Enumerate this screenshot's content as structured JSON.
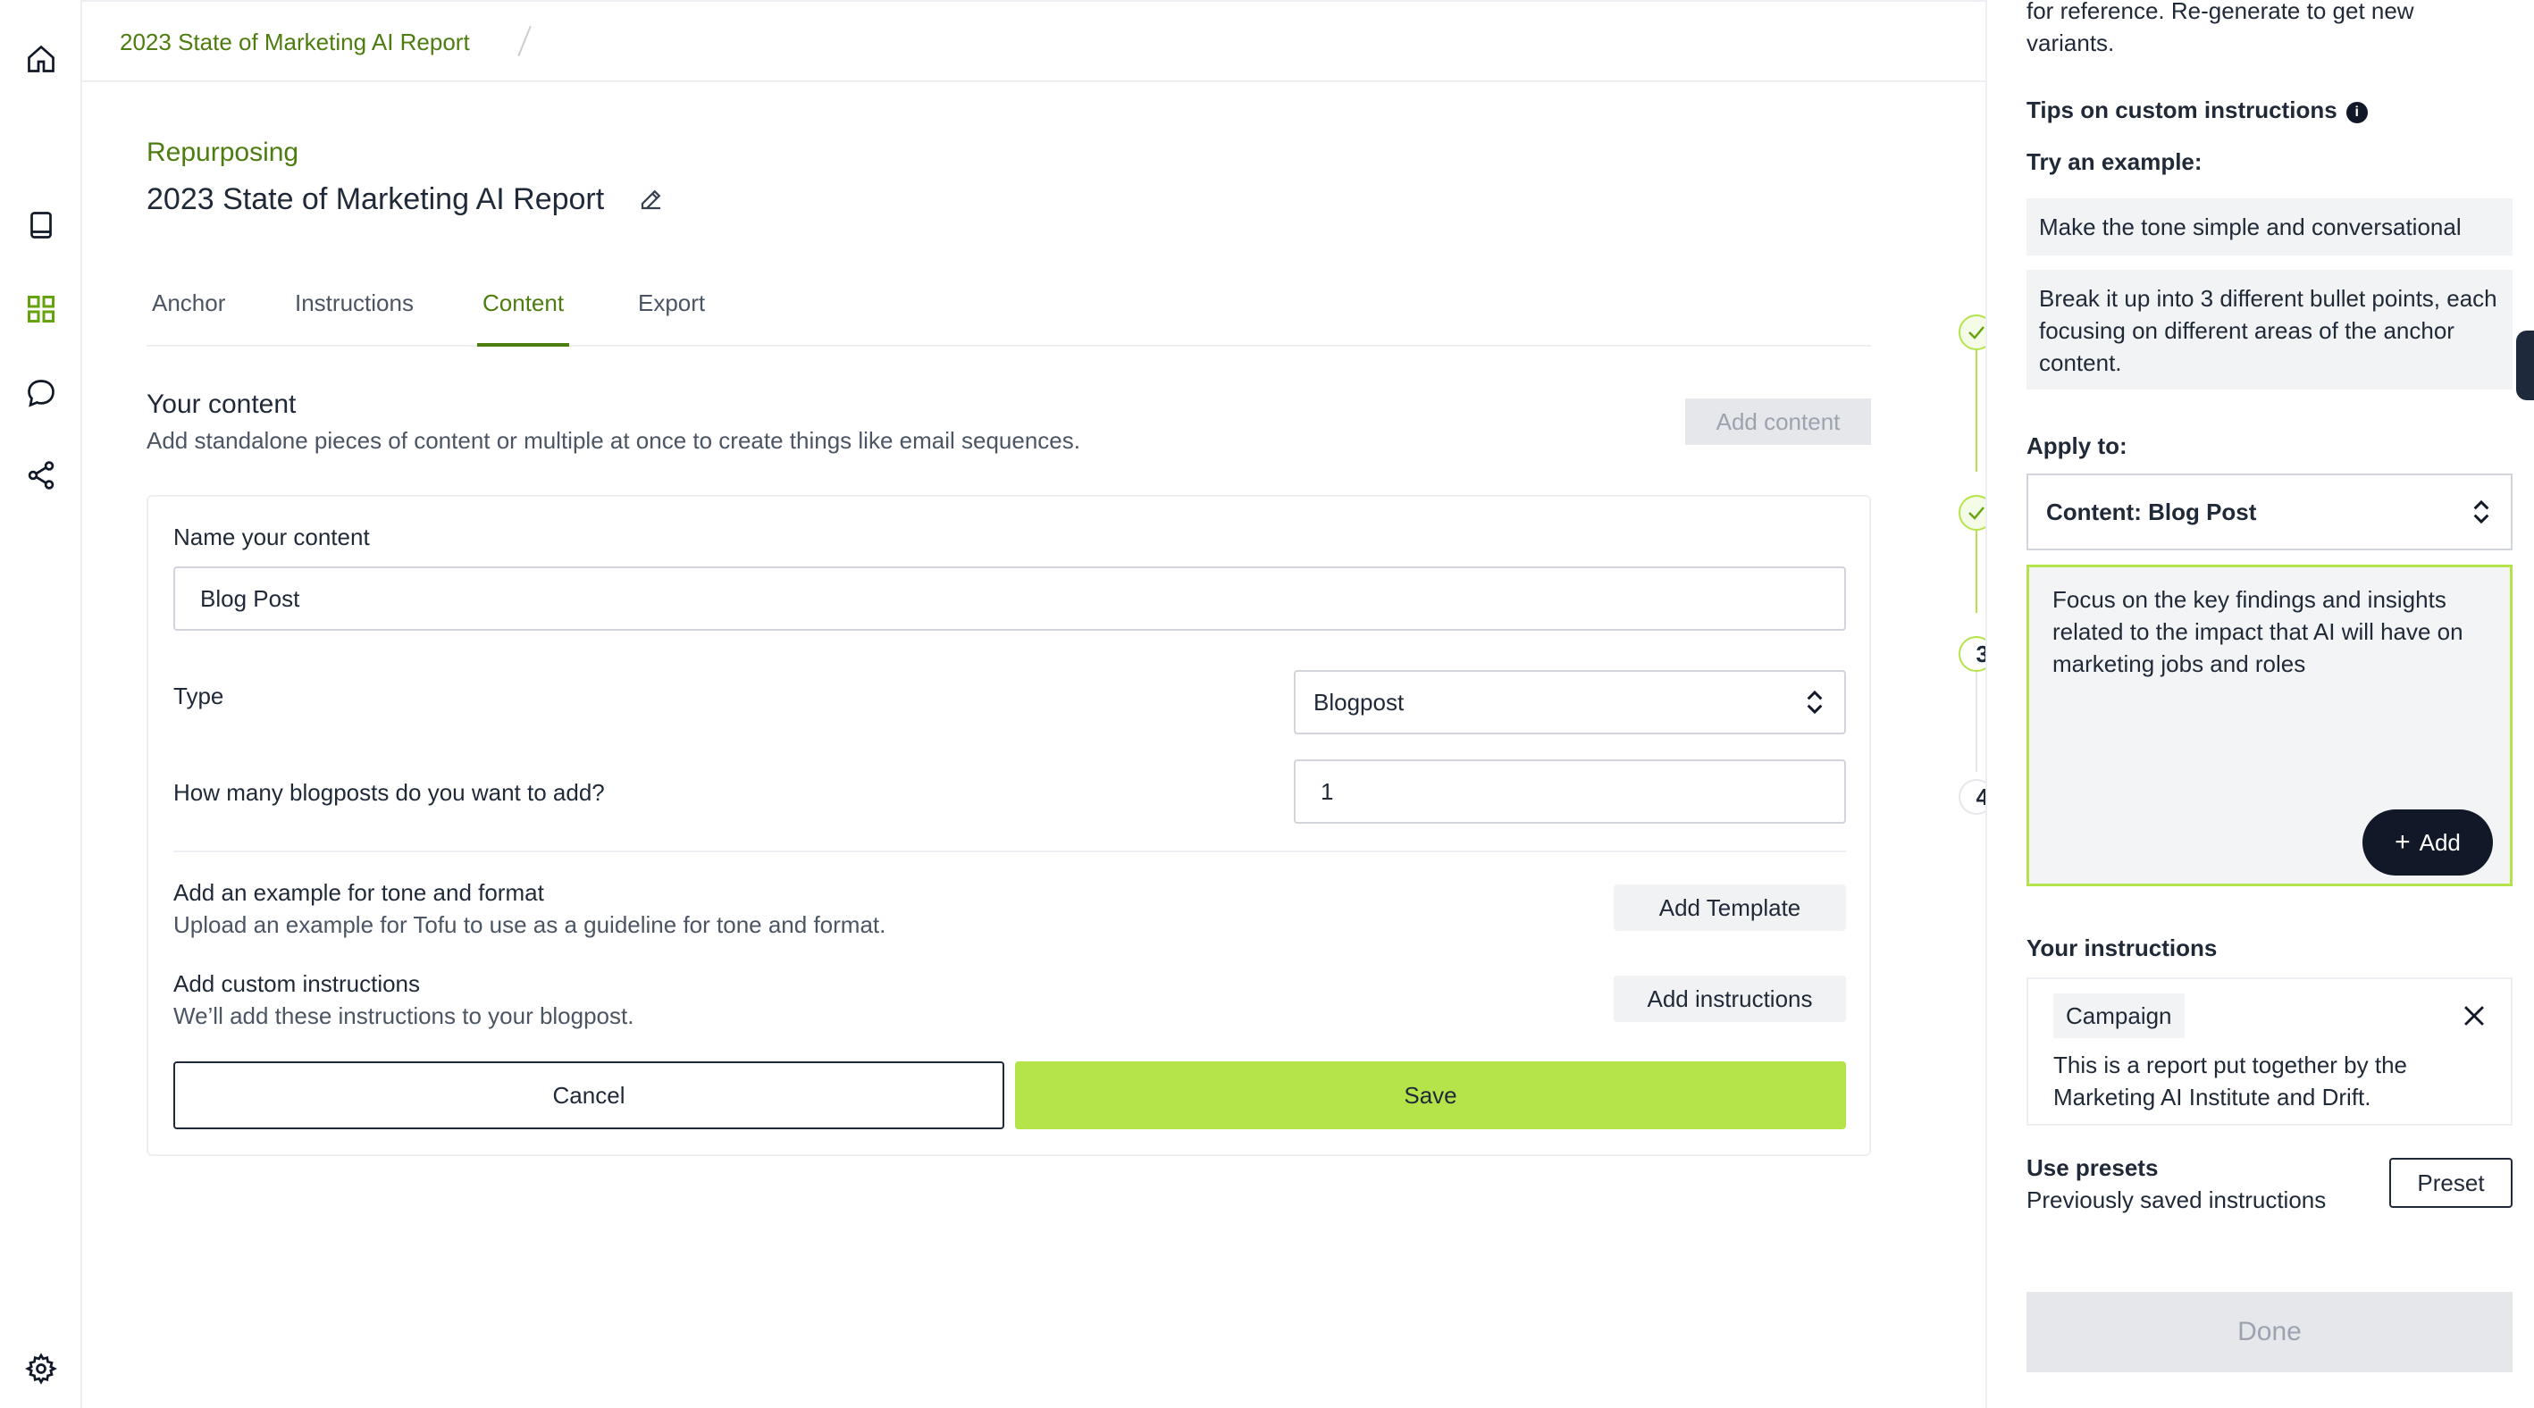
{
  "breadcrumb": {
    "title": "2023 State of Marketing AI Report"
  },
  "header": {
    "section": "Repurposing",
    "title": "2023 State of Marketing AI Report"
  },
  "tabs": [
    {
      "label": "Anchor"
    },
    {
      "label": "Instructions"
    },
    {
      "label": "Content",
      "active": true
    },
    {
      "label": "Export"
    }
  ],
  "content": {
    "title": "Your content",
    "subtitle": "Add standalone pieces of content or multiple at once to create things like email sequences.",
    "add_button": "Add content"
  },
  "form": {
    "name_label": "Name your content",
    "name_value": "Blog Post",
    "type_label": "Type",
    "type_value": "Blogpost",
    "count_label": "How many blogposts do you want to add?",
    "count_value": "1",
    "example_label": "Add an example for tone and format",
    "example_sub": "Upload an example for Tofu to use as a guideline for tone and format.",
    "example_button": "Add Template",
    "custom_label": "Add custom instructions",
    "custom_sub": "We’ll add these instructions to your blogpost.",
    "custom_button": "Add instructions",
    "cancel": "Cancel",
    "save": "Save"
  },
  "steps": [
    {
      "state": "done"
    },
    {
      "state": "done"
    },
    {
      "label": "3"
    },
    {
      "label": "4"
    }
  ],
  "panel": {
    "top_text": "for reference. Re-generate to get new variants.",
    "tips_title": "Tips on custom instructions",
    "info_glyph": "i",
    "try_example": "Try an example:",
    "examples": [
      "Make the tone simple and conversational",
      "Break it up into 3 different bullet points, each focusing on different areas of the anchor content."
    ],
    "apply_to": "Apply to:",
    "apply_value": "Content: Blog Post",
    "instruction_text": "Focus on the key findings and insights related to the impact that AI will have on marketing jobs and roles",
    "add_button": "Add",
    "your_instructions": "Your instructions",
    "instruction_tag": "Campaign",
    "instruction_body": "This is a report put together by the Marketing AI Institute and Drift.",
    "presets_title": "Use presets",
    "presets_sub": "Previously saved instructions",
    "preset_button": "Preset",
    "done_button": "Done"
  },
  "colors": {
    "accent_green": "#4d7c0f",
    "lime": "#b5e34a",
    "disabled": "#e5e7eb"
  }
}
